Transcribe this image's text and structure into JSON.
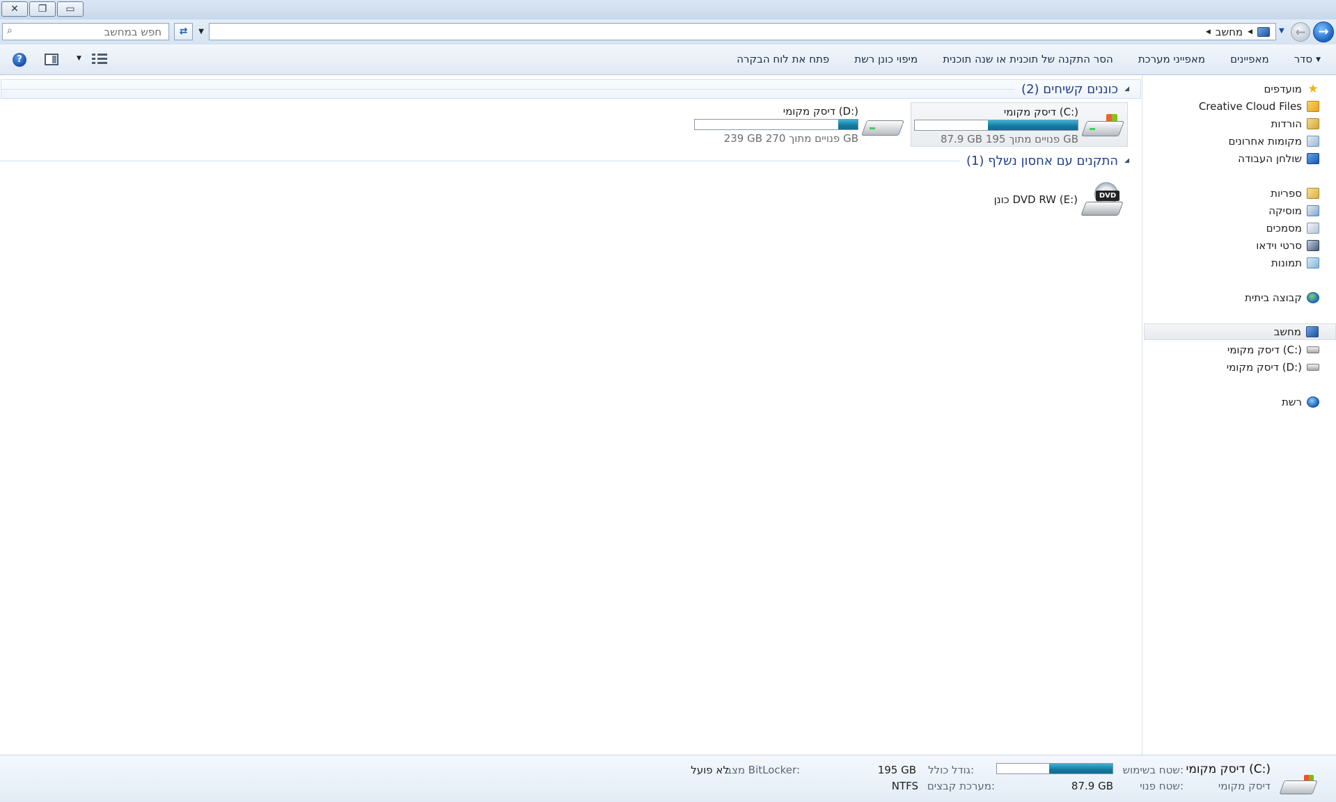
{
  "window": {
    "close_glyph": "✕",
    "restore_glyph": "❐",
    "minimize_glyph": "▭"
  },
  "address_bar": {
    "crumbs": [
      "מחשב"
    ],
    "search_placeholder": "חפש במחשב"
  },
  "toolbar": {
    "organize": "סדר",
    "properties": "מאפיינים",
    "system_properties": "מאפייני מערכת",
    "uninstall": "הסר התקנה של תוכנית או שנה תוכנית",
    "map_drive": "מיפוי כונן רשת",
    "control_panel": "פתח את לוח הבקרה"
  },
  "nav": {
    "favorites": "מועדפים",
    "creative_cloud": "Creative Cloud Files",
    "downloads": "הורדות",
    "recent": "מקומות אחרונים",
    "desktop": "שולחן העבודה",
    "libraries": "ספריות",
    "music": "מוסיקה",
    "documents": "מסמכים",
    "videos": "סרטי וידאו",
    "pictures": "תמונות",
    "homegroup": "קבוצה ביתית",
    "computer": "מחשב",
    "drive_c": "דיסק מקומי (C:)",
    "drive_d": "דיסק מקומי (D:)",
    "network": "רשת"
  },
  "groups": {
    "hdd_title": "כוננים קשיחים (2)",
    "removable_title": "התקנים עם אחסון נשלף (1)"
  },
  "drives": {
    "c": {
      "name": "דיסק מקומי (C:)",
      "free_text": "87.9 GB פנויים מתוך 195 GB",
      "used_fraction": 0.55
    },
    "d": {
      "name": "דיסק מקומי (D:)",
      "free_text": "239 GB פנויים מתוך 270 GB",
      "used_fraction": 0.12
    },
    "e": {
      "name": "כונן DVD RW (E:)",
      "label": "DVD"
    }
  },
  "details": {
    "name": "דיסק מקומי (C:)",
    "type": "דיסק מקומי",
    "used_label": "שטח בשימוש:",
    "free_label": "שטח פנוי:",
    "free_value": "87.9 GB",
    "total_label": "גודל כולל:",
    "total_value": "195 GB",
    "fs_label": "מערכת קבצים:",
    "fs_value": "NTFS",
    "bitlocker_label": "מצב BitLocker:",
    "bitlocker_value": "לא פועל",
    "used_fraction": 0.55
  }
}
